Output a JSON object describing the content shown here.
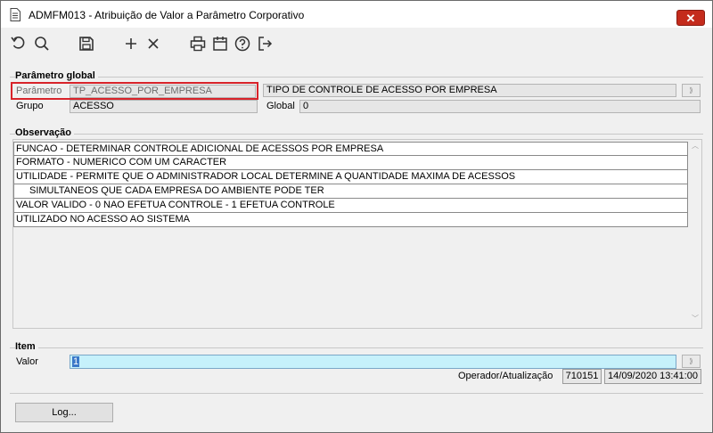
{
  "window": {
    "title": "ADMFM013 - Atribuição de Valor a Parâmetro Corporativo",
    "close_label": "✕"
  },
  "toolbar": {
    "buttons": [
      {
        "name": "undo",
        "icon": "undo-icon"
      },
      {
        "name": "search",
        "icon": "search-icon"
      },
      {
        "name": "save",
        "icon": "save-icon"
      },
      {
        "name": "add",
        "icon": "plus-icon"
      },
      {
        "name": "delete",
        "icon": "close-icon"
      },
      {
        "name": "print",
        "icon": "printer-icon"
      },
      {
        "name": "calendar",
        "icon": "calendar-icon"
      },
      {
        "name": "help",
        "icon": "help-icon"
      },
      {
        "name": "exit",
        "icon": "exit-icon"
      }
    ]
  },
  "parametro_global": {
    "group_title": "Parâmetro global",
    "parametro_label": "Parâmetro",
    "parametro_value": "TP_ACESSO_POR_EMPRESA",
    "descricao_value": "TIPO DE CONTROLE DE ACESSO POR EMPRESA",
    "grupo_label": "Grupo",
    "grupo_value": "ACESSO",
    "global_label": "Global",
    "global_value": "0"
  },
  "observacao": {
    "group_title": "Observação",
    "lines": [
      "FUNCAO - DETERMINAR CONTROLE ADICIONAL DE ACESSOS POR EMPRESA",
      "FORMATO - NUMERICO COM UM CARACTER",
      "UTILIDADE - PERMITE QUE O ADMINISTRADOR LOCAL DETERMINE A QUANTIDADE MAXIMA DE ACESSOS",
      "SIMULTANEOS QUE CADA EMPRESA DO AMBIENTE PODE TER",
      "VALOR VALIDO - 0 NAO EFETUA CONTROLE - 1 EFETUA CONTROLE",
      "UTILIZADO NO ACESSO AO SISTEMA"
    ]
  },
  "item": {
    "group_title": "Item",
    "valor_label": "Valor",
    "valor_value": "1",
    "operador_label": "Operador/Atualização",
    "operador_value": "710151",
    "atualizacao_value": "14/09/2020 13:41:00"
  },
  "log_button_label": "Log...",
  "colors": {
    "highlight_border": "#d8232a",
    "value_field_bg": "#c6f1fb",
    "close_button": "#c42b1c"
  }
}
